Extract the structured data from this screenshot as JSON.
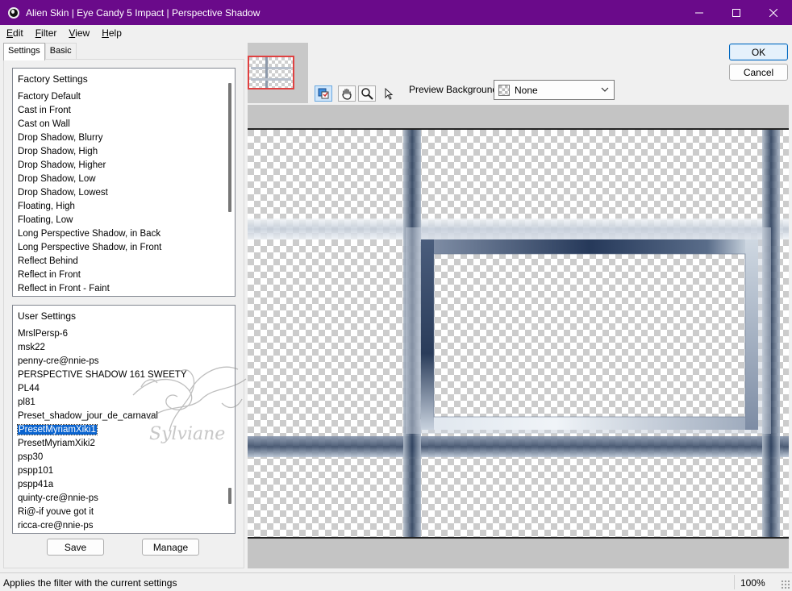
{
  "window": {
    "title": "Alien Skin | Eye Candy 5 Impact | Perspective Shadow"
  },
  "menu": [
    {
      "accel": "E",
      "rest": "dit"
    },
    {
      "accel": "F",
      "rest": "ilter"
    },
    {
      "accel": "V",
      "rest": "iew"
    },
    {
      "accel": "H",
      "rest": "elp"
    }
  ],
  "tabs": {
    "settings": "Settings",
    "basic": "Basic"
  },
  "factory": {
    "header": "Factory Settings",
    "items": [
      "Factory Default",
      "Cast in Front",
      "Cast on Wall",
      "Drop Shadow, Blurry",
      "Drop Shadow, High",
      "Drop Shadow, Higher",
      "Drop Shadow, Low",
      "Drop Shadow, Lowest",
      "Floating, High",
      "Floating, Low",
      "Long Perspective Shadow, in Back",
      "Long Perspective Shadow, in Front",
      "Reflect Behind",
      "Reflect in Front",
      "Reflect in Front - Faint"
    ]
  },
  "user": {
    "header": "User Settings",
    "selected": "PresetMyriamXiki1",
    "items": [
      "MrslPersp-6",
      "msk22",
      "penny-cre@nnie-ps",
      "PERSPECTIVE SHADOW 161 SWEETY",
      "PL44",
      "pl81",
      "Preset_shadow_jour_de_carnaval",
      "PresetMyriamXiki1",
      "PresetMyriamXiki2",
      "psp30",
      "pspp101",
      "pspp41a",
      "quinty-cre@nnie-ps",
      "Ri@-if youve got it",
      "ricca-cre@nnie-ps"
    ]
  },
  "buttons": {
    "save": "Save",
    "manage": "Manage",
    "ok": "OK",
    "cancel": "Cancel"
  },
  "toolbar": {
    "tools": [
      "toggle-preview-icon",
      "hand-icon",
      "zoom-icon",
      "pointer-icon"
    ]
  },
  "preview_background": {
    "label": "Preview Background:",
    "value": "None"
  },
  "watermark": {
    "text": "Sylviane"
  },
  "status": {
    "text": "Applies the filter with the current settings",
    "zoom": "100%"
  },
  "colors": {
    "titlebar": "#6a0a8a",
    "selection": "#0a64d0",
    "frame_dark": "#2c3f5c",
    "frame_light": "#d8e0ea"
  }
}
